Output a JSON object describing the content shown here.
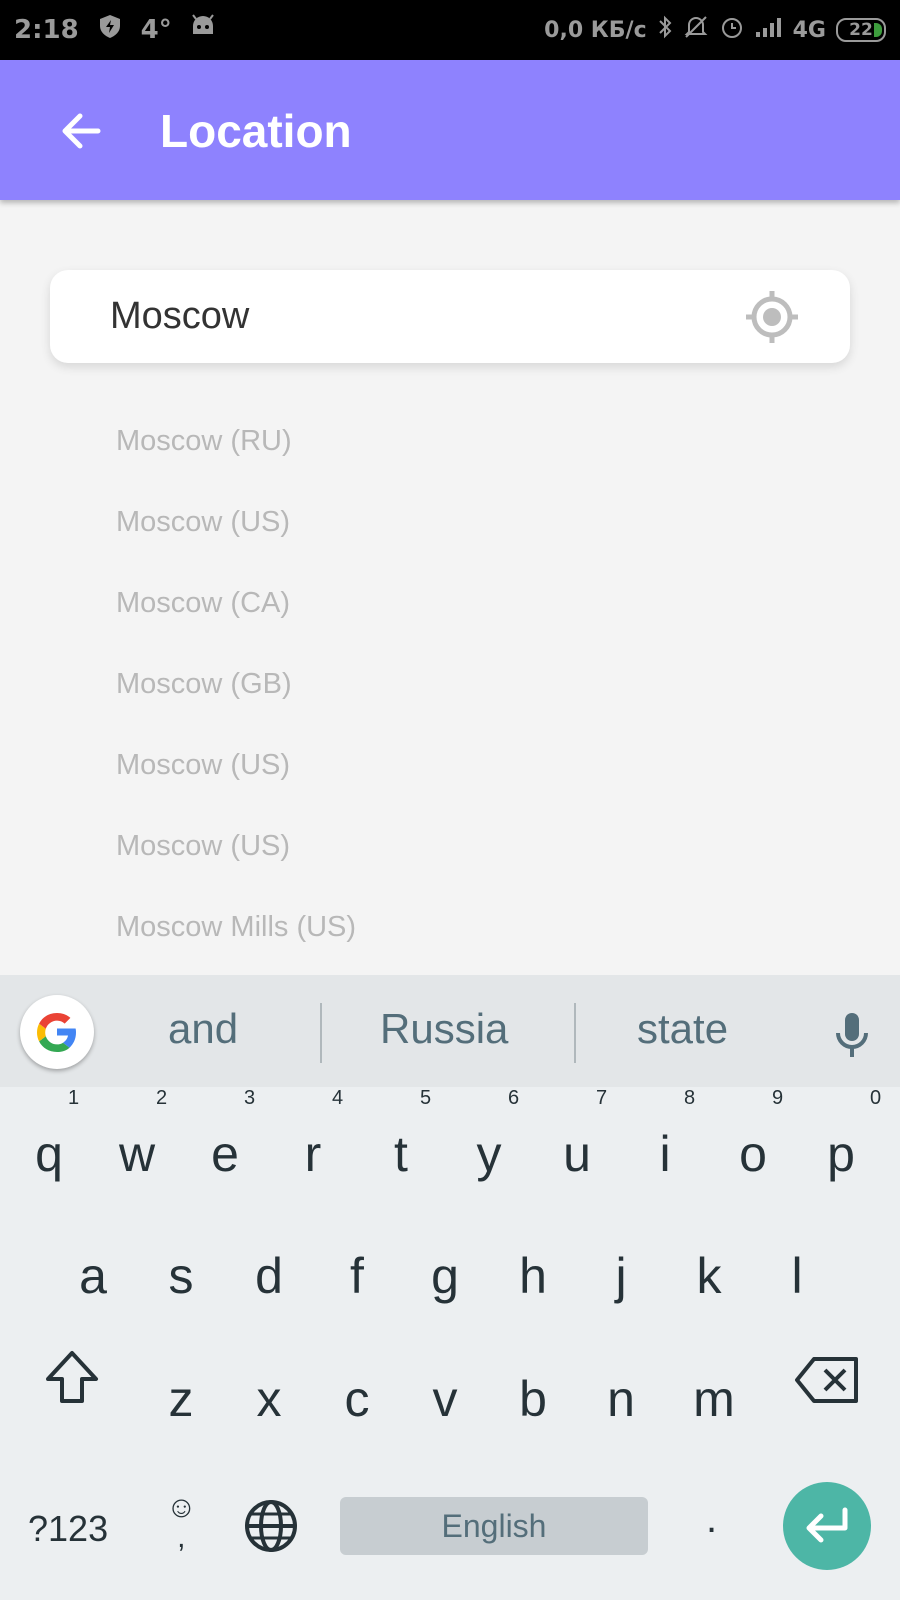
{
  "statusbar": {
    "time": "2:18",
    "temp": "4°",
    "network": "0,0 КБ/с",
    "signal": "4G",
    "battery": "22"
  },
  "appbar": {
    "title": "Location"
  },
  "search": {
    "value": "Moscow"
  },
  "results": [
    {
      "label": "Moscow (RU)"
    },
    {
      "label": "Moscow (US)"
    },
    {
      "label": "Moscow (CA)"
    },
    {
      "label": "Moscow (GB)"
    },
    {
      "label": "Moscow (US)"
    },
    {
      "label": "Moscow (US)"
    },
    {
      "label": "Moscow Mills (US)"
    }
  ],
  "keyboard": {
    "suggestions": [
      "and",
      "Russia",
      "state"
    ],
    "row1": [
      "q",
      "w",
      "e",
      "r",
      "t",
      "y",
      "u",
      "i",
      "o",
      "p"
    ],
    "row1_nums": [
      "1",
      "2",
      "3",
      "4",
      "5",
      "6",
      "7",
      "8",
      "9",
      "0"
    ],
    "row2": [
      "a",
      "s",
      "d",
      "f",
      "g",
      "h",
      "j",
      "k",
      "l"
    ],
    "row3": [
      "z",
      "x",
      "c",
      "v",
      "b",
      "n",
      "m"
    ],
    "symbols_label": "?123",
    "emoji_label": "☺",
    "comma_label": ",",
    "space_label": "English",
    "period_label": ".",
    "accent_color": "#4db6a6"
  },
  "colors": {
    "appbar": "#8e82fe",
    "background": "#f4f4f4"
  }
}
